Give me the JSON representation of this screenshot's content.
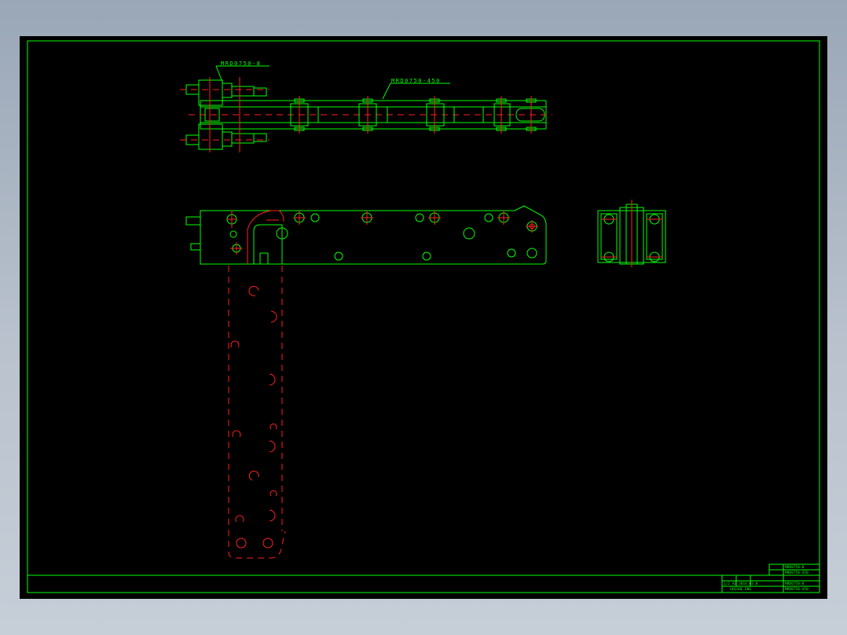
{
  "drawing": {
    "labels": {
      "top_left_part": "MRD0750-8",
      "top_chain_part": "MRD0750-450"
    },
    "title_block": {
      "row1_right": "MRD0750-8",
      "row2_right": "MRD0750-450",
      "mid_left": "1/1  A3  2016.03.0",
      "mid_right": "MRD0750-8",
      "bottom_left": "UGGSHE ENG",
      "bottom_right": "MRD0750-450"
    },
    "colors": {
      "background": "#000000",
      "outline": "#00ff00",
      "hidden_and_center_lines": "#ff2020"
    }
  }
}
